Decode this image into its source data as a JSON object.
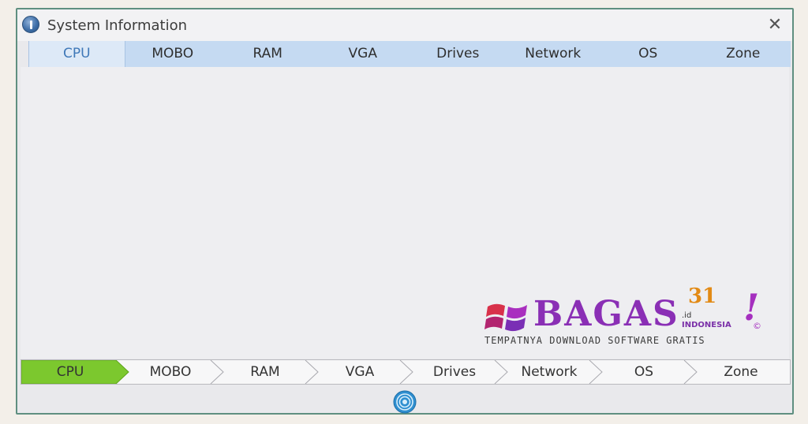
{
  "window": {
    "title": "System Information",
    "close_label": "✕"
  },
  "tabs": [
    {
      "label": "CPU",
      "active": true
    },
    {
      "label": "MOBO",
      "active": false
    },
    {
      "label": "RAM",
      "active": false
    },
    {
      "label": "VGA",
      "active": false
    },
    {
      "label": "Drives",
      "active": false
    },
    {
      "label": "Network",
      "active": false
    },
    {
      "label": "OS",
      "active": false
    },
    {
      "label": "Zone",
      "active": false
    }
  ],
  "steps": [
    {
      "label": "CPU",
      "active": true
    },
    {
      "label": "MOBO",
      "active": false
    },
    {
      "label": "RAM",
      "active": false
    },
    {
      "label": "VGA",
      "active": false
    },
    {
      "label": "Drives",
      "active": false
    },
    {
      "label": "Network",
      "active": false
    },
    {
      "label": "OS",
      "active": false
    },
    {
      "label": "Zone",
      "active": false
    }
  ],
  "watermark": {
    "brand": "BAGAS",
    "number": "31",
    "suffix": ".id",
    "country": "INDONESIA",
    "exclaim": "!",
    "copyright": "©",
    "tagline": "TEMPATNYA DOWNLOAD SOFTWARE GRATIS"
  },
  "colors": {
    "active_step": "#7cc82e",
    "tab_bar": "#c5daf2",
    "active_tab_text": "#3f78b8",
    "window_border": "#5f8f80"
  }
}
